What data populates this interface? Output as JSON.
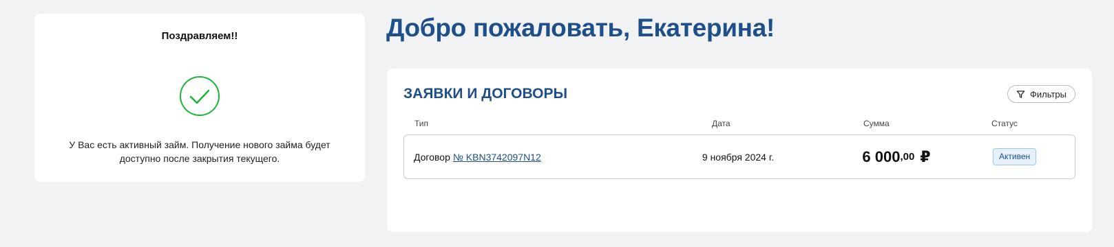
{
  "promo": {
    "title": "Поздравляем!!",
    "message": "У Вас есть активный займ. Получение нового займа будет доступно после закрытия текущего."
  },
  "welcome": "Добро пожаловать, Екатерина!",
  "applications": {
    "title": "ЗАЯВКИ И ДОГОВОРЫ",
    "filter_label": "Фильтры",
    "columns": [
      "Тип",
      "Дата",
      "Сумма",
      "Статус"
    ],
    "rows": [
      {
        "type": "Договор",
        "contract_number": "№ KBN3742097N12",
        "date": "9 ноября 2024 г.",
        "amount_int": "6 000",
        "amount_dec": ",00",
        "currency": "₽",
        "status": "Активен"
      }
    ]
  },
  "colors": {
    "accent": "#1e4f8a",
    "success": "#1db33a",
    "badge_bg": "#e6f1fd"
  },
  "icons": [
    "check-circle-icon",
    "filter-icon"
  ]
}
